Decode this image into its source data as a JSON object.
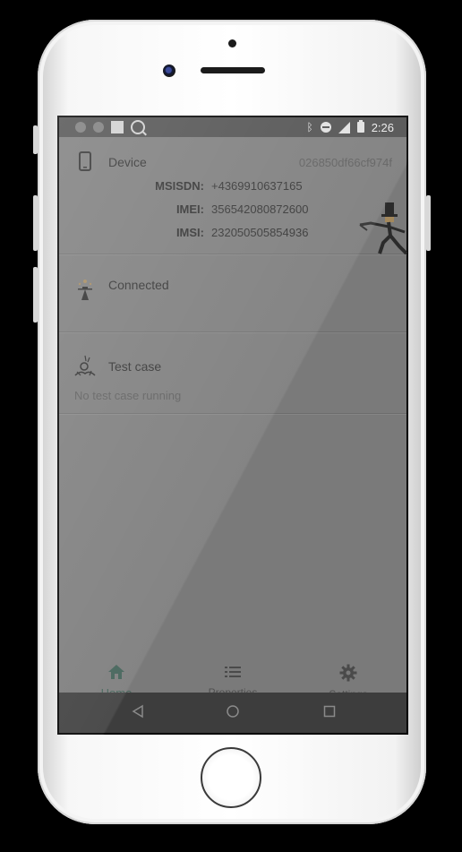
{
  "status_bar": {
    "time": "2:26",
    "icons": [
      "circle-icon",
      "circle-icon",
      "square-icon",
      "q-icon",
      "bluetooth-icon",
      "do-not-disturb-icon",
      "signal-icon",
      "battery-icon"
    ]
  },
  "device_card": {
    "title": "Device",
    "device_id": "026850df66cf974f",
    "fields": [
      {
        "label": "MSISDN:",
        "value": "+4369910637165"
      },
      {
        "label": "IMEI:",
        "value": "356542080872600"
      },
      {
        "label": "IMSI:",
        "value": "232050505854936"
      }
    ]
  },
  "connection_card": {
    "title": "Connected"
  },
  "test_case_card": {
    "title": "Test case",
    "status": "No test case running"
  },
  "bottom_nav": {
    "items": [
      {
        "label": "Home",
        "icon": "home-icon",
        "active": true
      },
      {
        "label": "Properties",
        "icon": "list-icon",
        "active": false
      },
      {
        "label": "Settings",
        "icon": "gear-icon",
        "active": false
      }
    ]
  },
  "colors": {
    "accent": "#3f5f55",
    "app_background": "#7a7a7a",
    "status_bar": "#4d4d4d",
    "nav_bar": "#3d3d3d"
  }
}
